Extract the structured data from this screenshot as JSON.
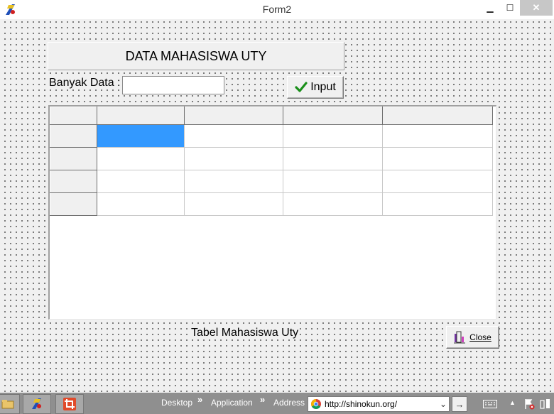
{
  "window": {
    "title": "Form2",
    "minimize_glyph": "▁",
    "maximize_glyph": "☐",
    "close_glyph": "✕",
    "app_icon": "delphi-icon"
  },
  "form": {
    "heading": "DATA MAHASISWA UTY",
    "count_label": "Banyak Data :",
    "count_value": "",
    "input_button_label": "Input",
    "input_button_icon": "checkmark-icon",
    "caption": "Tabel Mahasiswa Uty",
    "close_button_label": "Close",
    "close_button_icon": "door-exit-icon",
    "grid": {
      "columns": [
        "",
        "",
        "",
        "",
        ""
      ],
      "rows": [
        [
          "",
          "",
          "",
          "",
          ""
        ],
        [
          "",
          "",
          "",
          "",
          ""
        ],
        [
          "",
          "",
          "",
          "",
          ""
        ],
        [
          "",
          "",
          "",
          "",
          ""
        ]
      ],
      "selected_cell": [
        0,
        1
      ],
      "selection_color": "#3399ff"
    }
  },
  "taskbar": {
    "labels": [
      "Desktop",
      "Application",
      "Address"
    ],
    "chevron": "»",
    "address_url": "http://shinokun.org/",
    "go_glyph": "→",
    "dropdown_glyph": "⌄",
    "tray_arrow": "▲"
  },
  "colors": {
    "form_bg": "#f0f0f0",
    "check_green": "#1a8f1a",
    "taskbar_bg": "#8f8f8f"
  }
}
